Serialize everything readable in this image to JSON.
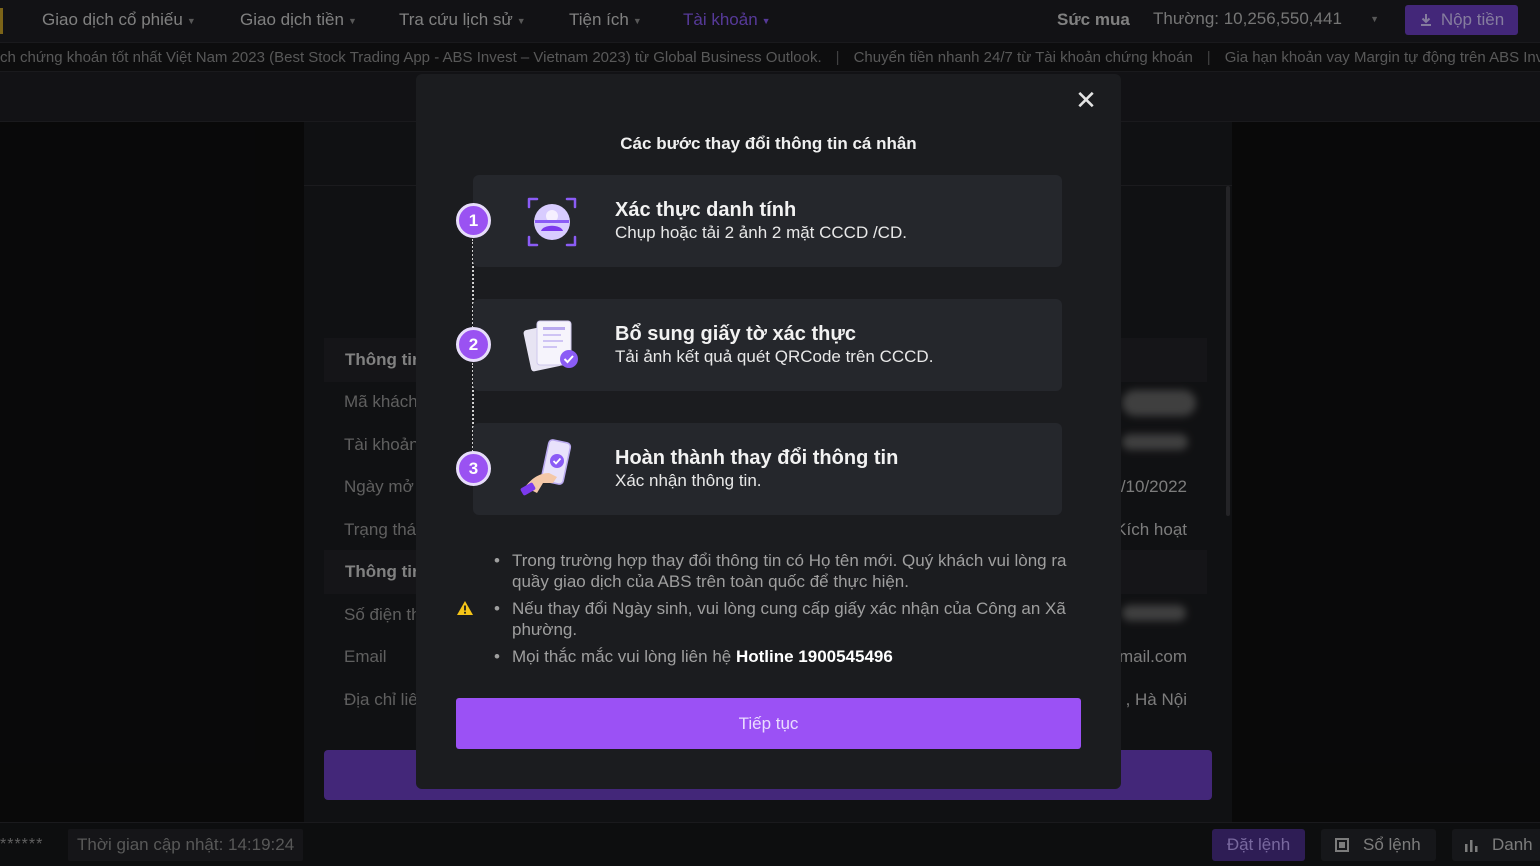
{
  "nav": {
    "items": [
      {
        "label": "Giao dịch cổ phiếu"
      },
      {
        "label": "Giao dịch tiền"
      },
      {
        "label": "Tra cứu lịch sử"
      },
      {
        "label": "Tiện ích"
      },
      {
        "label": "Tài khoản"
      }
    ],
    "buying_power_label": "Sức mua",
    "buying_power_value": "Thường: 10,256,550,441",
    "deposit_label": "Nộp tiền"
  },
  "ticker": [
    "ch chứng khoán tốt nhất Việt Nam 2023 (Best Stock Trading App - ABS Invest – Vietnam 2023) từ Global Business Outlook.",
    "Chuyển tiền nhanh 24/7 từ Tài khoản chứng khoán",
    "Gia hạn khoản vay Margin tự động trên ABS Inv"
  ],
  "background": {
    "section1": "Thông tin",
    "rows1": [
      {
        "label": "Mã khách",
        "value": ""
      },
      {
        "label": "Tài khoản",
        "value": ""
      },
      {
        "label": "Ngày mở",
        "value": "/10/2022"
      },
      {
        "label": "Trạng thái",
        "value": "Kích hoạt"
      }
    ],
    "section2": "Thông tin",
    "rows2": [
      {
        "label": "Số điện th",
        "value": ""
      },
      {
        "label": "Email",
        "value": "mail.com"
      },
      {
        "label": "Địa chỉ liê",
        "value": ", Hà Nội"
      }
    ]
  },
  "status": {
    "stars": "******",
    "update_time": "Thời gian cập nhật: 14:19:24",
    "order_label": "Đặt lệnh",
    "book_label": "Sổ lệnh",
    "list_label": "Danh"
  },
  "modal": {
    "title": "Các bước thay đổi thông tin cá nhân",
    "steps": [
      {
        "number": "1",
        "title": "Xác thực danh tính",
        "desc": "Chụp hoặc tải 2 ảnh 2 mặt CCCD /CD.",
        "icon": "face-id-icon"
      },
      {
        "number": "2",
        "title": "Bổ sung giấy tờ xác thực",
        "desc": "Tải ảnh kết quả quét QRCode trên CCCD.",
        "icon": "documents-check-icon"
      },
      {
        "number": "3",
        "title": "Hoàn thành thay đổi thông tin",
        "desc": "Xác nhận thông tin.",
        "icon": "phone-hand-icon"
      }
    ],
    "notes": [
      "Trong trường hợp thay đổi thông tin có Họ tên mới. Quý khách vui lòng ra quầy giao dịch của ABS trên toàn quốc để thực hiện.",
      "Nếu thay đổi Ngày sinh, vui lòng cung cấp giấy xác nhận của Công an Xã phường.",
      "Mọi thắc mắc vui lòng liên hệ "
    ],
    "hotline": "Hotline 1900545496",
    "continue_label": "Tiếp tục",
    "close_icon": "close-icon",
    "warning_icon": "warning-icon",
    "accent": "#9b51f5"
  }
}
